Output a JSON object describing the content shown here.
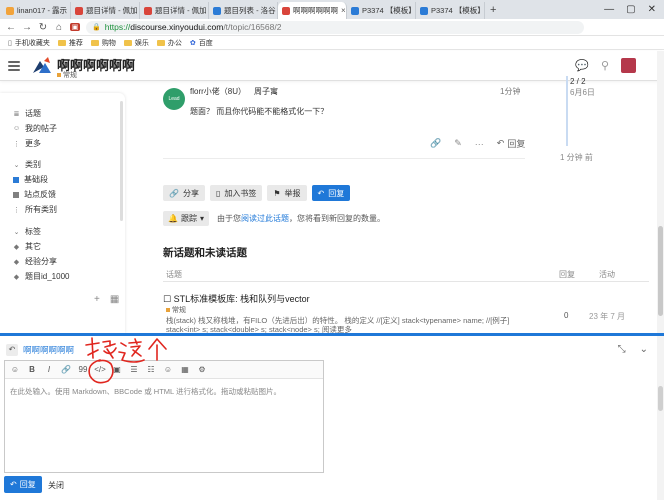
{
  "browser": {
    "tabs": [
      {
        "label": "linan017 - 露示",
        "color": "#f2a33a",
        "active": false
      },
      {
        "label": "题目详情 - 佩加",
        "color": "#d9453b",
        "active": false
      },
      {
        "label": "题目详情 - 佩加",
        "color": "#d9453b",
        "active": false
      },
      {
        "label": "题目列表 - 洛谷",
        "color": "#2b7bd6",
        "active": false
      },
      {
        "label": "啊啊啊啊啊啊",
        "color": "#d9453b",
        "active": true
      },
      {
        "label": "P3374 【模板】",
        "color": "#2b7bd6",
        "active": false
      },
      {
        "label": "P3374 【模板】",
        "color": "#2b7bd6",
        "active": false
      }
    ],
    "new_tab": "+",
    "url_proto": "https://",
    "url_host": "discourse.xinyoudui.com",
    "url_path": "/t/topic/16568/2",
    "bookmarks": [
      {
        "label": "手机收藏夹",
        "type": "device"
      },
      {
        "label": "推荐",
        "type": "folder"
      },
      {
        "label": "购物",
        "type": "folder"
      },
      {
        "label": "娱乐",
        "type": "folder"
      },
      {
        "label": "办公",
        "type": "folder"
      },
      {
        "label": "百度",
        "type": "link"
      }
    ]
  },
  "header": {
    "title": "啊啊啊啊啊啊",
    "category": "常规"
  },
  "sidebar": {
    "items_top": [
      {
        "icon": "≣",
        "label": "话题"
      },
      {
        "icon": "☺",
        "label": "我的帖子"
      },
      {
        "icon": "⋮",
        "label": "更多"
      }
    ],
    "section_categories": "类别",
    "categories": [
      {
        "label": "基础段",
        "color": "#2b7bd6"
      },
      {
        "label": "站点反馈",
        "color": "#808080"
      },
      {
        "label": "所有类别",
        "color": ""
      }
    ],
    "section_tags": "标签",
    "tags": [
      {
        "label": "其它"
      },
      {
        "label": "经验分享"
      },
      {
        "label": "题目id_1000"
      }
    ]
  },
  "post": {
    "avatar_text": "Lead",
    "username": "florr小佬（8U）",
    "extra": "周子寓",
    "time": "1分钟",
    "text": "题面？ 而且你代码能不能格式化一下？",
    "reply_label": "回复"
  },
  "timeline": {
    "count": "2 / 2",
    "date": "6月6日",
    "bottom": "1 分钟 前"
  },
  "topic_buttons": [
    {
      "label": "分享",
      "icon": "🔗",
      "primary": false
    },
    {
      "label": "加入书签",
      "icon": "▯",
      "primary": false
    },
    {
      "label": "举报",
      "icon": "⚑",
      "primary": false
    },
    {
      "label": "回复",
      "icon": "↶",
      "primary": true
    }
  ],
  "notify": {
    "button": "跟踪",
    "text_before": "由于您",
    "link": "阅读过此话题",
    "text_after": "，您将看到新回复的数量。"
  },
  "suggested": {
    "title": "新话题和未读话题",
    "col_topic": "话题",
    "col_replies": "回复",
    "col_activity": "活动",
    "rows": [
      {
        "title": "☐ STL标准模板库: 栈和队列与vector",
        "category": "常规",
        "excerpt": "栈(stack) 栈又称栈堆，有FILO（先进后出）的特性。 栈的定义 //[定义] stack<typename> name; //[例子] stack<int> s; stack<double> s; stack<node> s;   阅读更多",
        "replies": "0",
        "activity": "23 年 7 月"
      }
    ]
  },
  "composer": {
    "title": "啊啊啊啊啊啊",
    "toolbar": [
      "☺",
      "B",
      "I",
      "🔗",
      "99",
      "</>",
      "▣",
      "☰",
      "☷",
      "☺",
      "▦",
      "⚙"
    ],
    "placeholder": "在此处输入。使用 Markdown、BBCode 或 HTML 进行格式化。拖动或粘贴图片。",
    "submit": "回复",
    "cancel": "关闭"
  },
  "annotation": {
    "text": "按这个",
    "color": "#e0261f"
  }
}
